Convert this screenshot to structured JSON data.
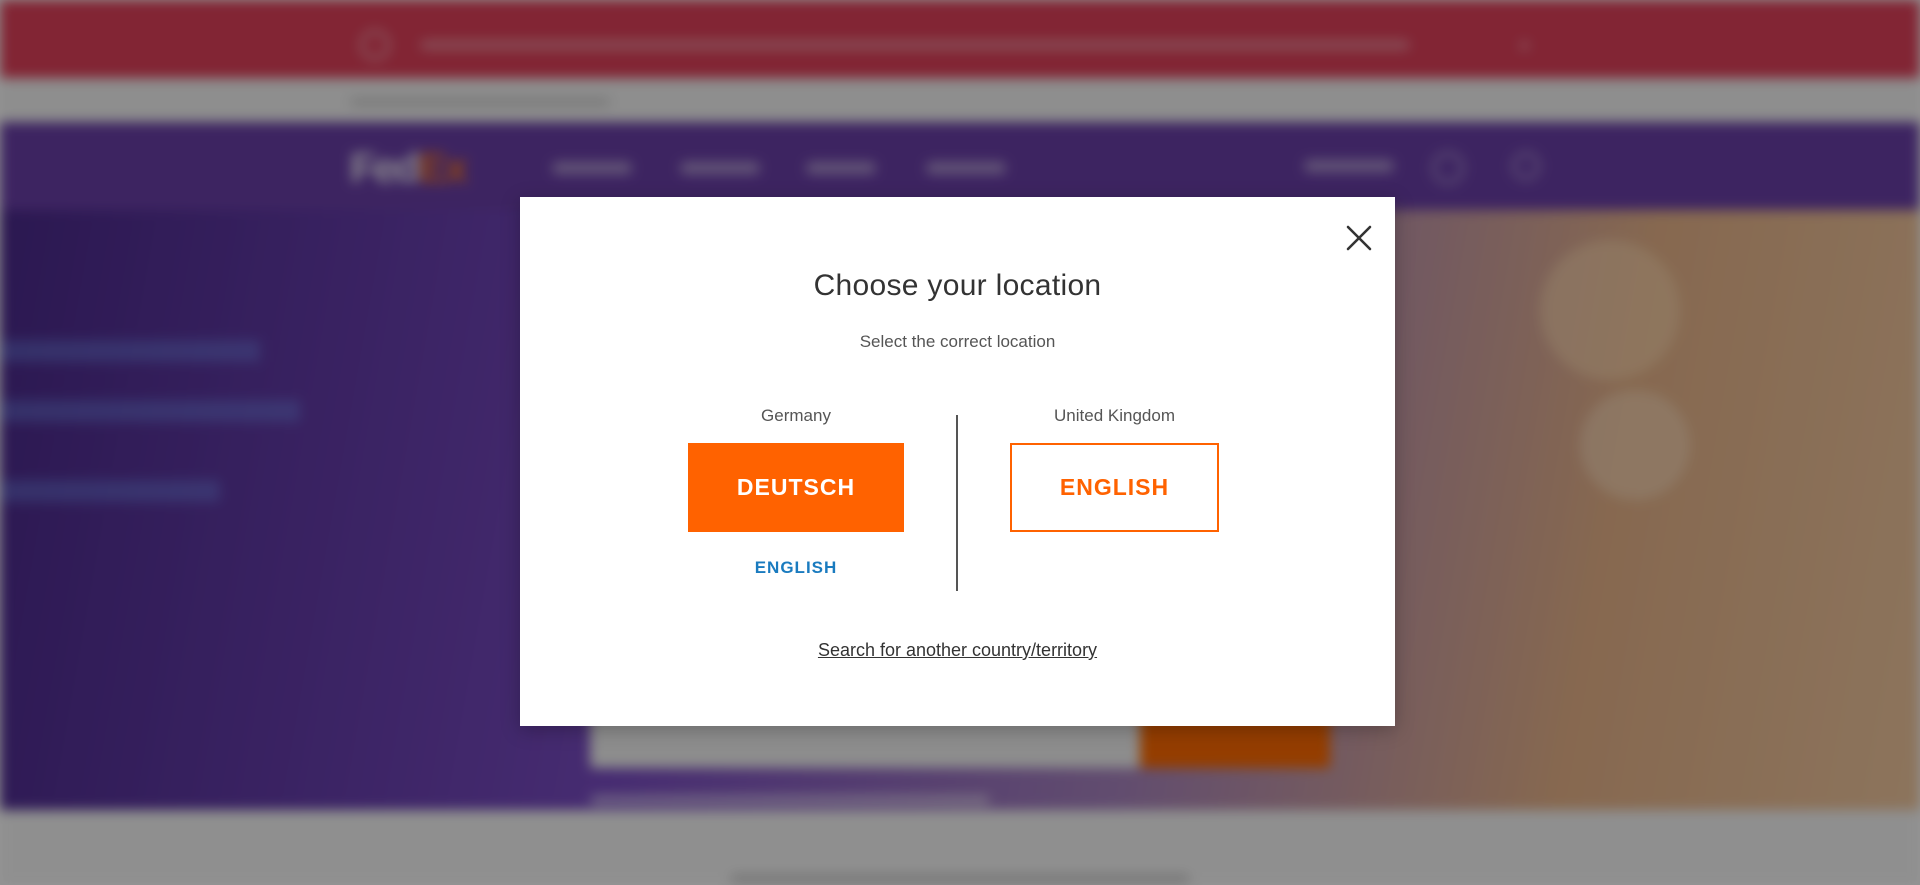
{
  "modal": {
    "title": "Choose your location",
    "subtitle": "Select the correct location",
    "close_icon": "close-icon",
    "left": {
      "country": "Germany",
      "primary_button": "DEUTSCH",
      "secondary_link": "ENGLISH"
    },
    "right": {
      "country": "United Kingdom",
      "primary_button": "ENGLISH"
    },
    "search_link": "Search for another country/territory"
  },
  "colors": {
    "accent": "#ff6200",
    "link_blue": "#1a7bbf",
    "overlay": "rgba(0,0,0,0.42)",
    "background_alert": "#e0405a",
    "background_nav": "#6a3fa8"
  }
}
